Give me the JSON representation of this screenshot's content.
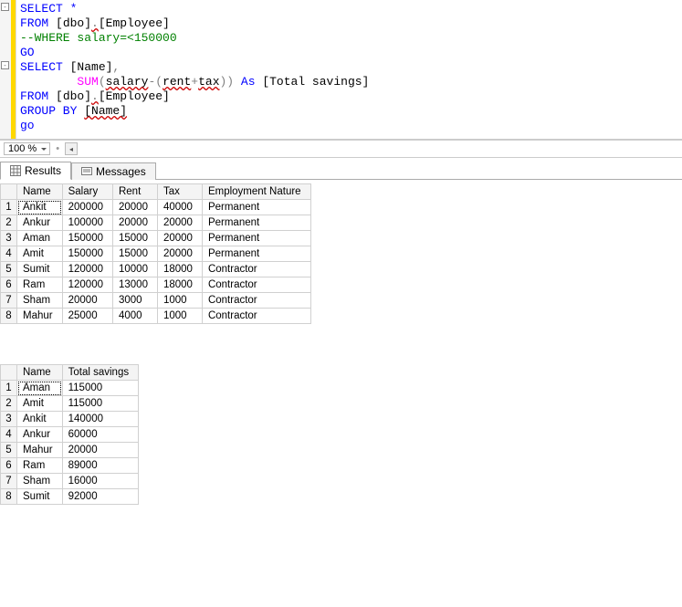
{
  "code": {
    "lines": [
      {
        "kind": "kw",
        "t": "SELECT *"
      },
      {
        "kind": "mix",
        "parts": [
          {
            "c": "kw",
            "t": "FROM "
          },
          {
            "c": "",
            "t": "[dbo]"
          },
          {
            "c": "squig op",
            "t": "."
          },
          {
            "c": "",
            "t": "[Employee]"
          }
        ]
      },
      {
        "kind": "cmt",
        "t": "--WHERE salary=<150000"
      },
      {
        "kind": "kw",
        "t": "GO"
      },
      {
        "kind": "mix",
        "parts": [
          {
            "c": "kw",
            "t": "SELECT "
          },
          {
            "c": "",
            "t": "[Name]"
          },
          {
            "c": "op",
            "t": ","
          }
        ]
      },
      {
        "kind": "mix",
        "indent": "        ",
        "parts": [
          {
            "c": "fn",
            "t": "SUM"
          },
          {
            "c": "op",
            "t": "("
          },
          {
            "c": "squig",
            "t": "salary"
          },
          {
            "c": "op",
            "t": "-("
          },
          {
            "c": "squig",
            "t": "rent"
          },
          {
            "c": "op",
            "t": "+"
          },
          {
            "c": "squig",
            "t": "tax"
          },
          {
            "c": "op",
            "t": "))"
          },
          {
            "c": "kw",
            "t": " As "
          },
          {
            "c": "",
            "t": "[Total savings]"
          }
        ]
      },
      {
        "kind": "mix",
        "parts": [
          {
            "c": "kw",
            "t": "FROM "
          },
          {
            "c": "",
            "t": "[dbo]"
          },
          {
            "c": "squig op",
            "t": "."
          },
          {
            "c": "",
            "t": "[Employee]"
          }
        ]
      },
      {
        "kind": "mix",
        "parts": [
          {
            "c": "kw",
            "t": "GROUP BY "
          },
          {
            "c": "squig",
            "t": "[Name]"
          }
        ]
      },
      {
        "kind": "kw",
        "t": "go"
      }
    ]
  },
  "zoom": {
    "value": "100 %"
  },
  "tabs": {
    "results": "Results",
    "messages": "Messages"
  },
  "grid1": {
    "headers": [
      "Name",
      "Salary",
      "Rent",
      "Tax",
      "Employment Nature"
    ],
    "rows": [
      [
        "Ankit",
        "200000",
        "20000",
        "40000",
        "Permanent"
      ],
      [
        "Ankur",
        "100000",
        "20000",
        "20000",
        "Permanent"
      ],
      [
        "Aman",
        "150000",
        "15000",
        "20000",
        "Permanent"
      ],
      [
        "Amit",
        "150000",
        "15000",
        "20000",
        "Permanent"
      ],
      [
        "Sumit",
        "120000",
        "10000",
        "18000",
        "Contractor"
      ],
      [
        "Ram",
        "120000",
        "13000",
        "18000",
        "Contractor"
      ],
      [
        "Sham",
        "20000",
        "3000",
        "1000",
        "Contractor"
      ],
      [
        "Mahur",
        "25000",
        "4000",
        "1000",
        "Contractor"
      ]
    ]
  },
  "grid2": {
    "headers": [
      "Name",
      "Total savings"
    ],
    "rows": [
      [
        "Aman",
        "115000"
      ],
      [
        "Amit",
        "115000"
      ],
      [
        "Ankit",
        "140000"
      ],
      [
        "Ankur",
        "60000"
      ],
      [
        "Mahur",
        "20000"
      ],
      [
        "Ram",
        "89000"
      ],
      [
        "Sham",
        "16000"
      ],
      [
        "Sumit",
        "92000"
      ]
    ]
  }
}
